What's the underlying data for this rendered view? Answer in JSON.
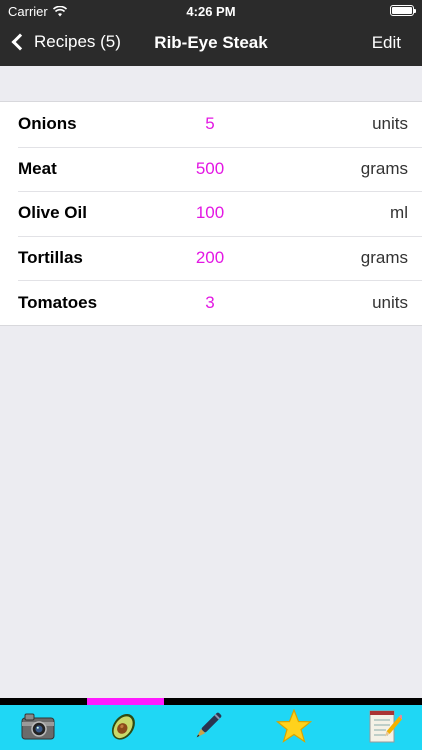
{
  "status_bar": {
    "carrier": "Carrier",
    "time": "4:26 PM"
  },
  "nav": {
    "back_label": "Recipes (5)",
    "title": "Rib-Eye Steak",
    "edit_label": "Edit"
  },
  "ingredients": [
    {
      "name": "Onions",
      "quantity": "5",
      "unit": "units"
    },
    {
      "name": "Meat",
      "quantity": "500",
      "unit": "grams"
    },
    {
      "name": "Olive Oil",
      "quantity": "100",
      "unit": "ml"
    },
    {
      "name": "Tortillas",
      "quantity": "200",
      "unit": "grams"
    },
    {
      "name": "Tomatoes",
      "quantity": "3",
      "unit": "units"
    }
  ],
  "tabbar": {
    "tabs": [
      {
        "icon": "camera-icon"
      },
      {
        "icon": "avocado-icon",
        "selected": true
      },
      {
        "icon": "pen-icon"
      },
      {
        "icon": "star-icon"
      },
      {
        "icon": "notepad-icon"
      }
    ]
  },
  "colors": {
    "nav_background": "#2b2b2b",
    "quantity_text": "#e318e3",
    "tabbar_background": "#1fd7f5",
    "tab_indicator": "#ff1aff",
    "page_background": "#ececf1"
  }
}
